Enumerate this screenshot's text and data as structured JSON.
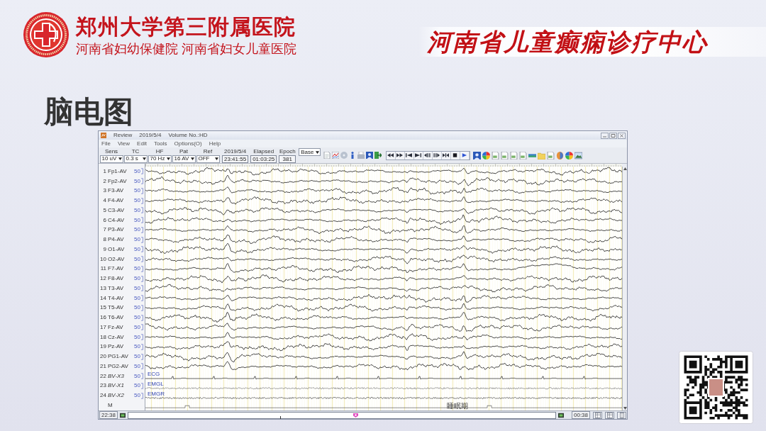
{
  "header": {
    "hospital_name": "郑州大学第三附属医院",
    "hospital_subtitle": "河南省妇幼保健院 河南省妇女儿童医院",
    "center_name": "河南省儿童癫痫诊疗中心"
  },
  "heading": "脑电图",
  "eeg_window": {
    "title_parts": [
      "Review",
      "2019/5/4",
      "Volume No.:HD"
    ],
    "menu": [
      "File",
      "View",
      "Edit",
      "Tools",
      "Options(O)",
      "Help"
    ],
    "settings": [
      {
        "label": "Sens",
        "value": "10 uV"
      },
      {
        "label": "TC",
        "value": "0.3 s"
      },
      {
        "label": "HF",
        "value": "70 Hz"
      },
      {
        "label": "Pat",
        "value": "16 AV"
      },
      {
        "label": "Ref",
        "value": "OFF"
      }
    ],
    "readouts": [
      {
        "label": "2019/5/4",
        "value": "23:41:55"
      },
      {
        "label": "Elapsed",
        "value": "01:03:25"
      },
      {
        "label": "Epoch",
        "value": "381"
      }
    ],
    "mode_select": "Base",
    "channels": [
      {
        "number": "1",
        "name": "Fp1-AV",
        "scale": "50",
        "kind": "eeg"
      },
      {
        "number": "2",
        "name": "Fp2-AV",
        "scale": "50",
        "kind": "eeg"
      },
      {
        "number": "3",
        "name": "F3-AV",
        "scale": "50",
        "kind": "eeg"
      },
      {
        "number": "4",
        "name": "F4-AV",
        "scale": "50",
        "kind": "eeg"
      },
      {
        "number": "5",
        "name": "C3-AV",
        "scale": "50",
        "kind": "eeg"
      },
      {
        "number": "6",
        "name": "C4-AV",
        "scale": "50",
        "kind": "eeg"
      },
      {
        "number": "7",
        "name": "P3-AV",
        "scale": "50",
        "kind": "eeg"
      },
      {
        "number": "8",
        "name": "P4-AV",
        "scale": "50",
        "kind": "eeg"
      },
      {
        "number": "9",
        "name": "O1-AV",
        "scale": "50",
        "kind": "eeg"
      },
      {
        "number": "10",
        "name": "O2-AV",
        "scale": "50",
        "kind": "eeg"
      },
      {
        "number": "11",
        "name": "F7-AV",
        "scale": "50",
        "kind": "eeg"
      },
      {
        "number": "12",
        "name": "F8-AV",
        "scale": "50",
        "kind": "eeg"
      },
      {
        "number": "13",
        "name": "T3-AV",
        "scale": "50",
        "kind": "eeg"
      },
      {
        "number": "14",
        "name": "T4-AV",
        "scale": "50",
        "kind": "eeg"
      },
      {
        "number": "15",
        "name": "T5-AV",
        "scale": "50",
        "kind": "eeg"
      },
      {
        "number": "16",
        "name": "T6-AV",
        "scale": "50",
        "kind": "eeg"
      },
      {
        "number": "17",
        "name": "Fz-AV",
        "scale": "50",
        "kind": "eeg"
      },
      {
        "number": "18",
        "name": "Cz-AV",
        "scale": "50",
        "kind": "eeg"
      },
      {
        "number": "19",
        "name": "Pz-AV",
        "scale": "50",
        "kind": "eeg"
      },
      {
        "number": "20",
        "name": "PG1-AV",
        "scale": "50",
        "kind": "eeg"
      },
      {
        "number": "21",
        "name": "PG2-AV",
        "scale": "50",
        "kind": "eeg"
      },
      {
        "number": "22",
        "name": "BV-X3",
        "scale": "50",
        "kind": "ecg",
        "trace_label": "ECG"
      },
      {
        "number": "23",
        "name": "BV-X1",
        "scale": "50",
        "kind": "emg",
        "trace_label": "EMGL"
      },
      {
        "number": "24",
        "name": "BV-X2",
        "scale": "50",
        "kind": "emg",
        "trace_label": "EMGR"
      },
      {
        "name": "M",
        "kind": "marker"
      }
    ],
    "annotation": "睡眠期",
    "timeline": {
      "start": "22:38",
      "end": "00:38",
      "level": 0.533
    }
  }
}
